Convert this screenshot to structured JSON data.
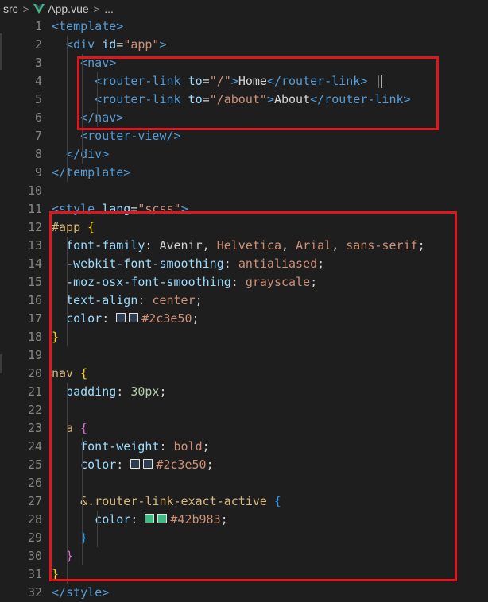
{
  "breadcrumb": {
    "folder": "src",
    "file": "App.vue",
    "more": "...",
    "sep": ">"
  },
  "colors": {
    "box": "#e0161c",
    "swatch_dark": "#2c3e50",
    "swatch_green": "#42b983"
  },
  "lines": [
    {
      "n": "1",
      "tokens": [
        {
          "c": "t-tag",
          "t": "<template>"
        }
      ]
    },
    {
      "n": "2",
      "tokens": [
        {
          "c": "t-tag",
          "t": "  <div "
        },
        {
          "c": "t-attr",
          "t": "id"
        },
        {
          "c": "t-punc",
          "t": "="
        },
        {
          "c": "t-str",
          "t": "\"app\""
        },
        {
          "c": "t-tag",
          "t": ">"
        }
      ]
    },
    {
      "n": "3",
      "tokens": [
        {
          "c": "t-tag",
          "t": "    <nav>"
        }
      ]
    },
    {
      "n": "4",
      "tokens": [
        {
          "c": "t-tag",
          "t": "      <router-link "
        },
        {
          "c": "t-attr",
          "t": "to"
        },
        {
          "c": "t-punc",
          "t": "="
        },
        {
          "c": "t-str",
          "t": "\"/\""
        },
        {
          "c": "t-tag",
          "t": ">"
        },
        {
          "c": "t-text",
          "t": "Home"
        },
        {
          "c": "t-tag",
          "t": "</router-link>"
        },
        {
          "c": "t-text",
          "t": " |"
        }
      ]
    },
    {
      "n": "5",
      "tokens": [
        {
          "c": "t-tag",
          "t": "      <router-link "
        },
        {
          "c": "t-attr",
          "t": "to"
        },
        {
          "c": "t-punc",
          "t": "="
        },
        {
          "c": "t-str",
          "t": "\"/about\""
        },
        {
          "c": "t-tag",
          "t": ">"
        },
        {
          "c": "t-text",
          "t": "About"
        },
        {
          "c": "t-tag",
          "t": "</router-link>"
        }
      ]
    },
    {
      "n": "6",
      "tokens": [
        {
          "c": "t-tag",
          "t": "    </nav>"
        }
      ]
    },
    {
      "n": "7",
      "tokens": [
        {
          "c": "t-tag",
          "t": "    <router-view/>"
        }
      ]
    },
    {
      "n": "8",
      "tokens": [
        {
          "c": "t-tag",
          "t": "  </div>"
        }
      ]
    },
    {
      "n": "9",
      "tokens": [
        {
          "c": "t-tag",
          "t": "</template>"
        }
      ]
    },
    {
      "n": "10",
      "tokens": []
    },
    {
      "n": "11",
      "tokens": [
        {
          "c": "t-tag",
          "t": "<style "
        },
        {
          "c": "t-attr",
          "t": "lang"
        },
        {
          "c": "t-punc",
          "t": "="
        },
        {
          "c": "t-str",
          "t": "\"scss\""
        },
        {
          "c": "t-tag",
          "t": ">"
        }
      ]
    },
    {
      "n": "12",
      "tokens": [
        {
          "c": "t-sel",
          "t": "#app"
        },
        {
          "c": "t-punc",
          "t": " "
        },
        {
          "c": "t-brace1",
          "t": "{"
        }
      ]
    },
    {
      "n": "13",
      "tokens": [
        {
          "c": "t-prop",
          "t": "  font-family"
        },
        {
          "c": "t-punc",
          "t": ": "
        },
        {
          "c": "t-text",
          "t": "Avenir"
        },
        {
          "c": "t-punc",
          "t": ", "
        },
        {
          "c": "t-val",
          "t": "Helvetica"
        },
        {
          "c": "t-punc",
          "t": ", "
        },
        {
          "c": "t-val",
          "t": "Arial"
        },
        {
          "c": "t-punc",
          "t": ", "
        },
        {
          "c": "t-val",
          "t": "sans-serif"
        },
        {
          "c": "t-punc",
          "t": ";"
        }
      ]
    },
    {
      "n": "14",
      "tokens": [
        {
          "c": "t-prop",
          "t": "  -webkit-font-smoothing"
        },
        {
          "c": "t-punc",
          "t": ": "
        },
        {
          "c": "t-val",
          "t": "antialiased"
        },
        {
          "c": "t-punc",
          "t": ";"
        }
      ]
    },
    {
      "n": "15",
      "tokens": [
        {
          "c": "t-prop",
          "t": "  -moz-osx-font-smoothing"
        },
        {
          "c": "t-punc",
          "t": ": "
        },
        {
          "c": "t-val",
          "t": "grayscale"
        },
        {
          "c": "t-punc",
          "t": ";"
        }
      ]
    },
    {
      "n": "16",
      "tokens": [
        {
          "c": "t-prop",
          "t": "  text-align"
        },
        {
          "c": "t-punc",
          "t": ": "
        },
        {
          "c": "t-val",
          "t": "center"
        },
        {
          "c": "t-punc",
          "t": ";"
        }
      ]
    },
    {
      "n": "17",
      "tokens": [
        {
          "c": "t-prop",
          "t": "  color"
        },
        {
          "c": "t-punc",
          "t": ": "
        },
        {
          "c": "swatch",
          "t": "#2c3e50"
        },
        {
          "c": "t-val",
          "t": "#2c3e50"
        },
        {
          "c": "t-punc",
          "t": ";"
        }
      ]
    },
    {
      "n": "18",
      "tokens": [
        {
          "c": "t-brace1",
          "t": "}"
        }
      ]
    },
    {
      "n": "19",
      "tokens": []
    },
    {
      "n": "20",
      "tokens": [
        {
          "c": "t-sel",
          "t": "nav"
        },
        {
          "c": "t-punc",
          "t": " "
        },
        {
          "c": "t-brace1",
          "t": "{"
        }
      ]
    },
    {
      "n": "21",
      "tokens": [
        {
          "c": "t-prop",
          "t": "  padding"
        },
        {
          "c": "t-punc",
          "t": ": "
        },
        {
          "c": "t-num",
          "t": "30px"
        },
        {
          "c": "t-punc",
          "t": ";"
        }
      ]
    },
    {
      "n": "22",
      "tokens": []
    },
    {
      "n": "23",
      "tokens": [
        {
          "c": "t-sel",
          "t": "  a"
        },
        {
          "c": "t-punc",
          "t": " "
        },
        {
          "c": "t-brace2",
          "t": "{"
        }
      ]
    },
    {
      "n": "24",
      "tokens": [
        {
          "c": "t-prop",
          "t": "    font-weight"
        },
        {
          "c": "t-punc",
          "t": ": "
        },
        {
          "c": "t-val",
          "t": "bold"
        },
        {
          "c": "t-punc",
          "t": ";"
        }
      ]
    },
    {
      "n": "25",
      "tokens": [
        {
          "c": "t-prop",
          "t": "    color"
        },
        {
          "c": "t-punc",
          "t": ": "
        },
        {
          "c": "swatch",
          "t": "#2c3e50"
        },
        {
          "c": "t-val",
          "t": "#2c3e50"
        },
        {
          "c": "t-punc",
          "t": ";"
        }
      ]
    },
    {
      "n": "26",
      "tokens": []
    },
    {
      "n": "27",
      "tokens": [
        {
          "c": "t-sel",
          "t": "    &.router-link-exact-active"
        },
        {
          "c": "t-punc",
          "t": " "
        },
        {
          "c": "t-brace3",
          "t": "{"
        }
      ]
    },
    {
      "n": "28",
      "tokens": [
        {
          "c": "t-prop",
          "t": "      color"
        },
        {
          "c": "t-punc",
          "t": ": "
        },
        {
          "c": "swatch",
          "t": "#42b983"
        },
        {
          "c": "t-val",
          "t": "#42b983"
        },
        {
          "c": "t-punc",
          "t": ";"
        }
      ]
    },
    {
      "n": "29",
      "tokens": [
        {
          "c": "t-brace3",
          "t": "    }"
        }
      ]
    },
    {
      "n": "30",
      "tokens": [
        {
          "c": "t-brace2",
          "t": "  }"
        }
      ]
    },
    {
      "n": "31",
      "tokens": [
        {
          "c": "t-brace1",
          "t": "}"
        }
      ]
    },
    {
      "n": "32",
      "tokens": [
        {
          "c": "t-tag",
          "t": "</style>"
        }
      ]
    }
  ]
}
